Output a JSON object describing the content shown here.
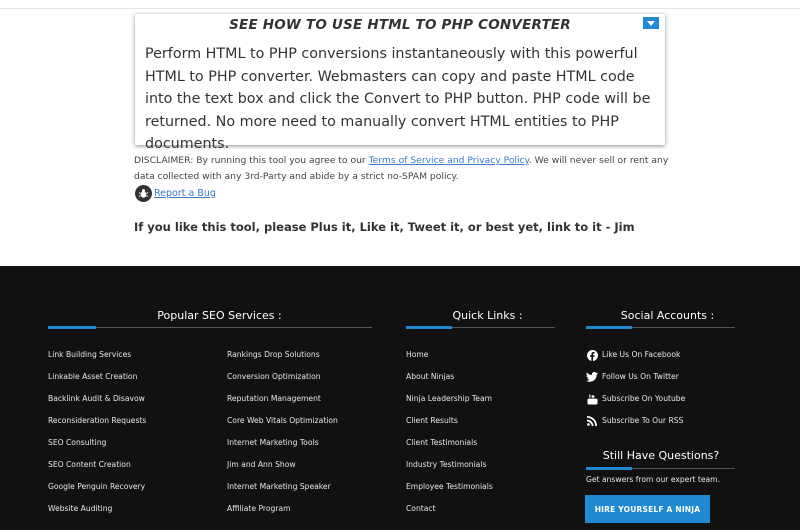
{
  "howto": {
    "title": "SEE HOW TO USE HTML TO PHP CONVERTER",
    "text": "Perform HTML to PHP conversions instantaneously with this powerful HTML to PHP converter. Webmasters can copy and paste HTML code into the text box and click the Convert to PHP button. PHP code will be returned. No more need to manually convert HTML entities to PHP documents."
  },
  "disclaimer": {
    "prefix": "DISCLAIMER: By running this tool you agree to our ",
    "link": "Terms of Service and Privacy Policy",
    "suffix": ". We will never sell or rent any data collected with any 3rd-Party and abide by a strict no-SPAM policy."
  },
  "report_bug": "Report a Bug",
  "like_line": "If you like this tool, please Plus it, Like it, Tweet it, or best yet, link to it - Jim",
  "footer": {
    "seo_heading": "Popular SEO Services :",
    "seo_col1": [
      "Link Building Services",
      "Linkable Asset Creation",
      "Backlink Audit & Disavow",
      "Reconsideration Requests",
      "SEO Consulting",
      "SEO Content Creation",
      "Google Penguin Recovery",
      "Website Auditing"
    ],
    "seo_col2": [
      "Rankings Drop Solutions",
      "Conversion Optimization",
      "Reputation Management",
      "Core Web Vitals Optimization",
      "Internet Marketing Tools",
      "Jim and Ann Show",
      "Internet Marketing Speaker",
      "Affiliate Program"
    ],
    "quick_heading": "Quick Links :",
    "quick_links": [
      "Home",
      "About Ninjas",
      "Ninja Leadership Team",
      "Client Results",
      "Client Testimonials",
      "Industry Testimonials",
      "Employee Testimonials",
      "Contact"
    ],
    "social_heading": "Social Accounts :",
    "social": [
      {
        "label": "Like Us On Facebook",
        "icon": "facebook-icon"
      },
      {
        "label": "Follow Us On Twitter",
        "icon": "twitter-icon"
      },
      {
        "label": "Subscribe On Youtube",
        "icon": "youtube-icon"
      },
      {
        "label": "Subscribe To Our RSS",
        "icon": "rss-icon"
      }
    ],
    "still_heading": "Still Have Questions?",
    "answers": "Get answers from our expert team.",
    "hire_button": "HIRE YOURSELF A NINJA"
  },
  "colors": {
    "accent": "#1f8ad1",
    "footer_bg": "#111111",
    "link": "#3a78c9"
  }
}
